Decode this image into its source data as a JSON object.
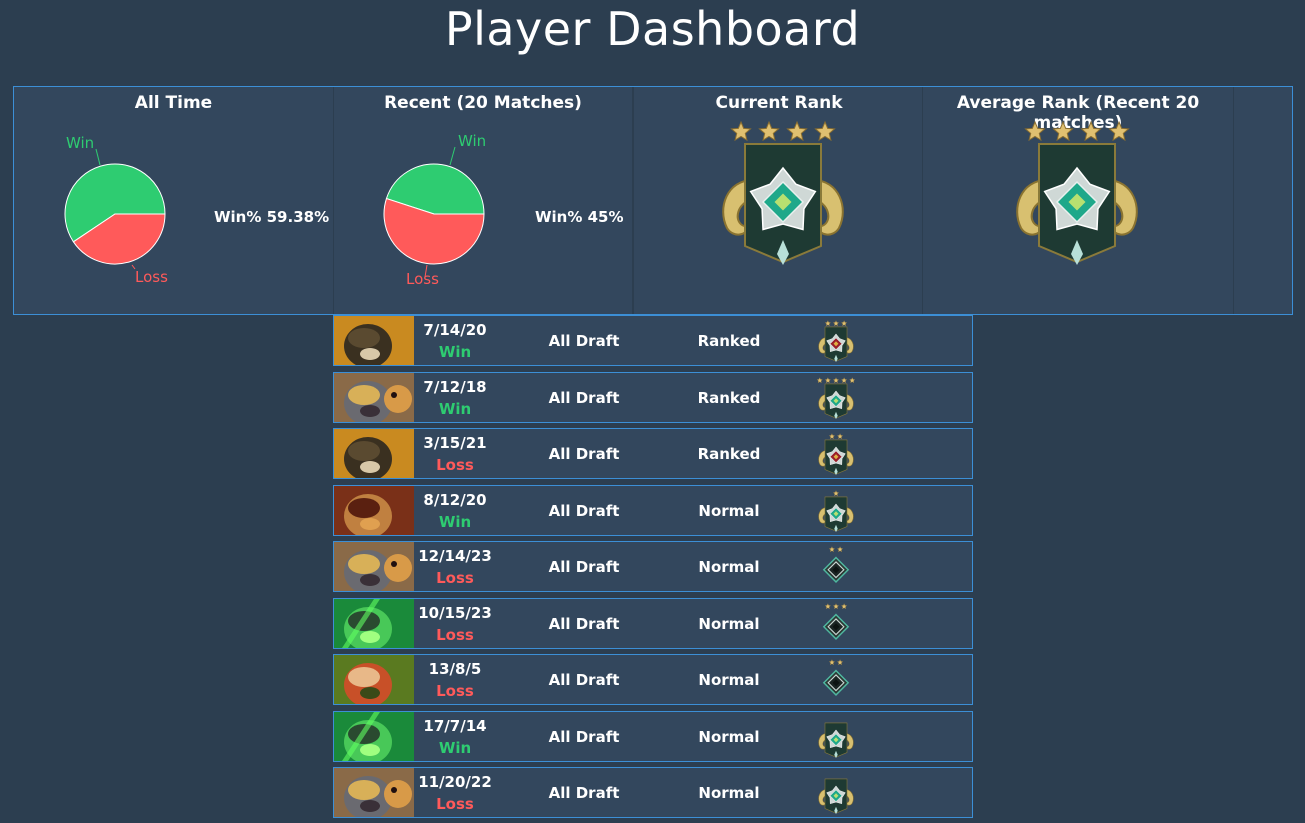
{
  "page": {
    "title": "Player Dashboard"
  },
  "colors": {
    "background": "#2c3e50",
    "panel": "#33475d",
    "border": "#3c8fd6",
    "win": "#2ecc71",
    "loss": "#ff5a5a"
  },
  "stats": {
    "all_time": {
      "heading": "All Time",
      "win_label": "Win",
      "loss_label": "Loss",
      "win_pct_text": "Win% 59.38%",
      "win_fraction": 0.5938
    },
    "recent": {
      "heading": "Recent (20 Matches)",
      "win_label": "Win",
      "loss_label": "Loss",
      "win_pct_text": "Win% 45%",
      "win_fraction": 0.45
    },
    "current_rank": {
      "heading": "Current Rank",
      "stars": 4
    },
    "average_rank": {
      "heading": "Average Rank (Recent 20 matches)",
      "stars": 4
    }
  },
  "matches": [
    {
      "hero": "hero-techies",
      "date": "7/14/20",
      "result": "Win",
      "mode": "All Draft",
      "type": "Ranked",
      "rank_icon": "rank-ancient",
      "rank_stars": 3
    },
    {
      "hero": "hero-bristleback",
      "date": "7/12/18",
      "result": "Win",
      "mode": "All Draft",
      "type": "Ranked",
      "rank_icon": "rank-legend",
      "rank_stars": 5
    },
    {
      "hero": "hero-techies",
      "date": "3/15/21",
      "result": "Loss",
      "mode": "All Draft",
      "type": "Ranked",
      "rank_icon": "rank-ancient",
      "rank_stars": 2
    },
    {
      "hero": "hero-earthshaker",
      "date": "8/12/20",
      "result": "Win",
      "mode": "All Draft",
      "type": "Normal",
      "rank_icon": "rank-legend",
      "rank_stars": 1
    },
    {
      "hero": "hero-bristleback",
      "date": "12/14/23",
      "result": "Loss",
      "mode": "All Draft",
      "type": "Normal",
      "rank_icon": "rank-archon",
      "rank_stars": 2
    },
    {
      "hero": "hero-necrophos",
      "date": "10/15/23",
      "result": "Loss",
      "mode": "All Draft",
      "type": "Normal",
      "rank_icon": "rank-archon",
      "rank_stars": 3
    },
    {
      "hero": "hero-lina",
      "date": "13/8/5",
      "result": "Loss",
      "mode": "All Draft",
      "type": "Normal",
      "rank_icon": "rank-archon",
      "rank_stars": 2
    },
    {
      "hero": "hero-necrophos",
      "date": "17/7/14",
      "result": "Win",
      "mode": "All Draft",
      "type": "Normal",
      "rank_icon": "rank-legend",
      "rank_stars": 0
    },
    {
      "hero": "hero-bristleback",
      "date": "11/20/22",
      "result": "Loss",
      "mode": "All Draft",
      "type": "Normal",
      "rank_icon": "rank-legend",
      "rank_stars": 0
    }
  ]
}
